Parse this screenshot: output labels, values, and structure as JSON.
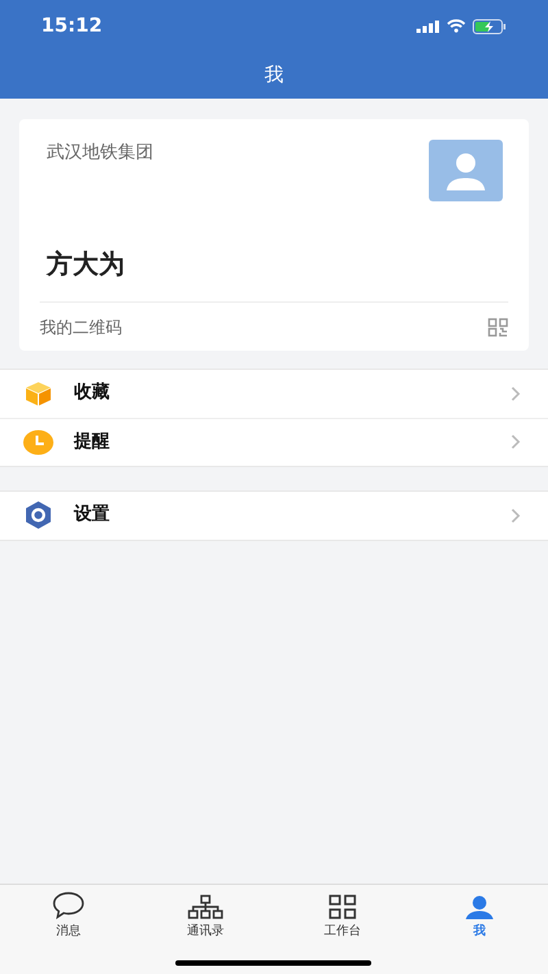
{
  "status_bar": {
    "time": "15:12"
  },
  "title": "我",
  "profile": {
    "organization": "武汉地铁集团",
    "name": "方大为",
    "qr_label": "我的二维码"
  },
  "menu_groups": [
    [
      {
        "kind": "box",
        "label": "收藏"
      },
      {
        "kind": "clock",
        "label": "提醒"
      }
    ],
    [
      {
        "kind": "gear",
        "label": "设置"
      }
    ]
  ],
  "tabs": [
    {
      "kind": "chat",
      "label": "消息",
      "selected": false
    },
    {
      "kind": "org",
      "label": "通讯录",
      "selected": false
    },
    {
      "kind": "grid",
      "label": "工作台",
      "selected": false
    },
    {
      "kind": "person",
      "label": "我",
      "selected": true
    }
  ]
}
